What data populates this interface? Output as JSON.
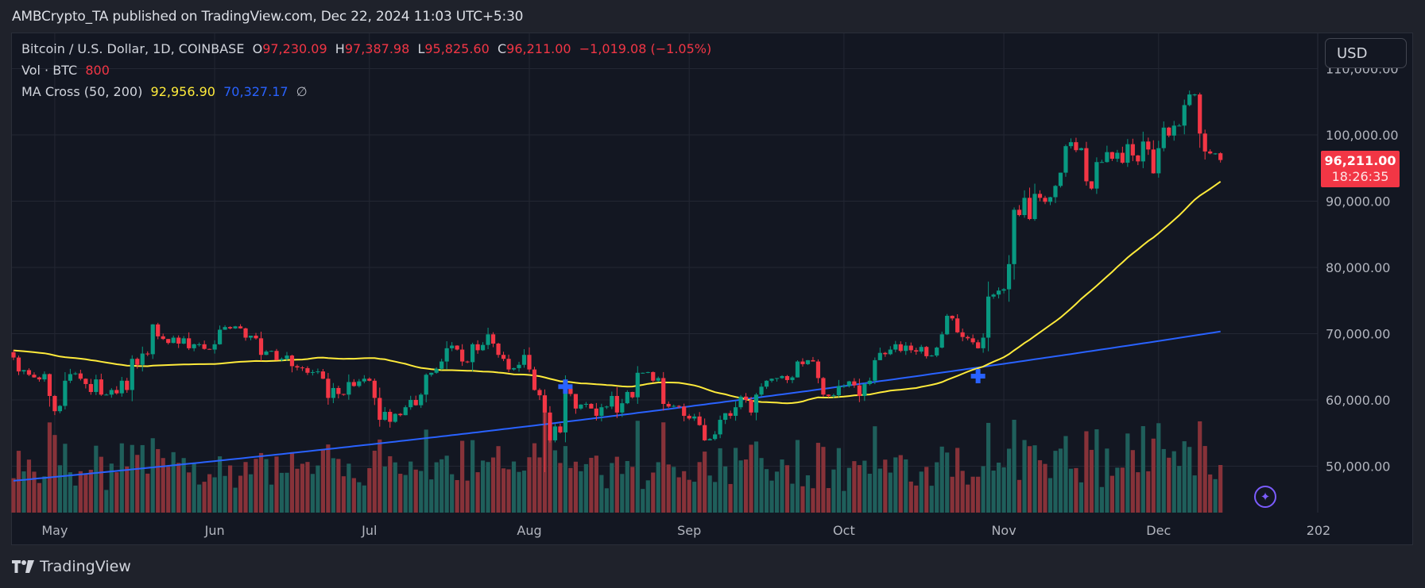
{
  "header": {
    "published_text": "AMBCrypto_TA published on TradingView.com, Dec 22, 2024 11:03 UTC+5:30"
  },
  "legend": {
    "symbol": "Bitcoin / U.S. Dollar, 1D, COINBASE",
    "o_label": "O",
    "o_value": "97,230.09",
    "h_label": "H",
    "h_value": "97,387.98",
    "l_label": "L",
    "l_value": "95,825.60",
    "c_label": "C",
    "c_value": "96,211.00",
    "change": "−1,019.08 (−1.05%)",
    "vol_label": "Vol · BTC",
    "vol_value": "800",
    "ma_label": "MA Cross (50, 200)",
    "ma_fast_value": "92,956.90",
    "ma_slow_value": "70,327.17",
    "ma_extra": "∅"
  },
  "currency_button": "USD",
  "last_price": {
    "value": "96,211.00",
    "countdown": "18:26:35"
  },
  "logo_text": "TradingView",
  "colors": {
    "up": "#089981",
    "down": "#f23645",
    "vol_up": "#1f5f5b",
    "vol_down": "#873239",
    "ma_fast": "#ffeb3b",
    "ma_slow": "#2962ff",
    "cross_marker": "#2962ff"
  },
  "chart_data": {
    "type": "candlestick",
    "title": "Bitcoin / U.S. Dollar, 1D, COINBASE",
    "ylabel": "USD",
    "ylim": [
      43000,
      111000
    ],
    "y_ticks": [
      50000,
      60000,
      70000,
      80000,
      90000,
      100000,
      110000
    ],
    "y_tick_labels": [
      "50,000.00",
      "60,000.00",
      "70,000.00",
      "80,000.00",
      "90,000.00",
      "100,000.00",
      "110,000.00"
    ],
    "x_tick_labels": [
      {
        "label": "May",
        "day_index": 8
      },
      {
        "label": "Jun",
        "day_index": 39
      },
      {
        "label": "Jul",
        "day_index": 69
      },
      {
        "label": "Aug",
        "day_index": 100
      },
      {
        "label": "Sep",
        "day_index": 131
      },
      {
        "label": "Oct",
        "day_index": 161
      },
      {
        "label": "Nov",
        "day_index": 192
      },
      {
        "label": "Dec",
        "day_index": 222
      },
      {
        "label": "202",
        "day_index": 253
      }
    ],
    "start_date": "2024-04-23",
    "end_date": "2024-12-22",
    "grid": true,
    "legend": "top-left",
    "closes": [
      66400,
      64300,
      64500,
      63800,
      63400,
      63100,
      63900,
      60600,
      58300,
      59100,
      62900,
      63900,
      64000,
      63200,
      62400,
      61200,
      63100,
      60800,
      60800,
      61500,
      61000,
      62900,
      61500,
      66200,
      65300,
      67000,
      66900,
      71400,
      69600,
      69200,
      68600,
      69400,
      68500,
      69300,
      67800,
      68400,
      68400,
      67700,
      67600,
      68400,
      70600,
      71000,
      70800,
      71100,
      70800,
      69400,
      69700,
      69300,
      66800,
      67300,
      67400,
      66000,
      66200,
      66700,
      65100,
      64900,
      64800,
      64100,
      64200,
      64300,
      63200,
      60300,
      61800,
      60900,
      60800,
      62700,
      62100,
      62800,
      63200,
      62900,
      60300,
      57000,
      58200,
      56700,
      57900,
      57700,
      58900,
      60000,
      59200,
      60800,
      63800,
      64100,
      64700,
      65800,
      67800,
      68200,
      67600,
      65800,
      65700,
      68400,
      67500,
      68300,
      69900,
      68500,
      66800,
      66200,
      64600,
      64800,
      65300,
      66800,
      64600,
      61500,
      60700,
      58100,
      53900,
      56000,
      55100,
      61700,
      60900,
      58700,
      59300,
      59400,
      58700,
      57600,
      58900,
      59000,
      60600,
      58100,
      59500,
      61200,
      60400,
      64100,
      64100,
      64200,
      62900,
      63300,
      59400,
      59000,
      59100,
      59000,
      57600,
      57200,
      57500,
      56200,
      53900,
      54100,
      54800,
      57000,
      58000,
      57600,
      58900,
      60500,
      60000,
      58100,
      60800,
      62000,
      62900,
      63200,
      63300,
      63600,
      63000,
      63400,
      65800,
      65400,
      66000,
      65800,
      63300,
      60800,
      60600,
      60700,
      62100,
      62100,
      62800,
      62200,
      60600,
      62400,
      62900,
      66000,
      67100,
      66900,
      67600,
      68400,
      67400,
      68200,
      67500,
      67300,
      68000,
      66600,
      66700,
      67900,
      69900,
      72700,
      72300,
      70200,
      69500,
      69300,
      68700,
      67800,
      69400,
      75600,
      75900,
      76500,
      76700,
      80500,
      88700,
      87900,
      90500,
      87300,
      91100,
      90500,
      89900,
      90600,
      92300,
      94300,
      98300,
      98900,
      97700,
      98000,
      93000,
      91900,
      95900,
      95900,
      97400,
      96400,
      97300,
      95800,
      98600,
      96900,
      96000,
      99000,
      97800,
      94200,
      98000,
      101100,
      99900,
      101400,
      101400,
      104500,
      106100,
      106100,
      100200,
      97500,
      97200,
      97200,
      96211
    ],
    "ma50_endpoint": 92956.9,
    "ma200_endpoint": 70327.17,
    "ma_cross_events": [
      {
        "type": "death_cross_marker",
        "day_index": 107,
        "price": 62000
      },
      {
        "type": "golden_cross_marker",
        "day_index": 187,
        "price": 63600
      }
    ],
    "volume_unit": "BTC",
    "last_volume": 800
  }
}
